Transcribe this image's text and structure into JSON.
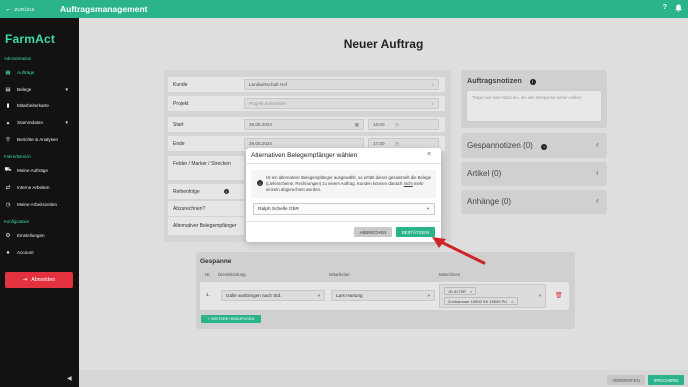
{
  "topbar": {
    "back_label": "ZURÜCK",
    "title": "Auftragsmanagement",
    "help_icon": "?",
    "bell_icon": "bell-icon"
  },
  "sidebar": {
    "logo": "FarmAct",
    "section_admin": "Administration",
    "items_admin": [
      {
        "label": "Aufträge",
        "icon": "clipboard-icon"
      },
      {
        "label": "Belege",
        "icon": "document-icon"
      },
      {
        "label": "Mitarbeiterkarte",
        "icon": "chart-icon"
      },
      {
        "label": "Stammdaten",
        "icon": "database-icon"
      },
      {
        "label": "Berichte & Analysen",
        "icon": "search-chart-icon"
      }
    ],
    "section_driver": "Fahrerbereich",
    "items_driver": [
      {
        "label": "Meine Aufträge",
        "icon": "truck-icon"
      },
      {
        "label": "Interne Arbeiten",
        "icon": "swap-icon"
      },
      {
        "label": "Meine Arbeitszeiten",
        "icon": "clock-icon"
      }
    ],
    "section_config": "Konfiguration",
    "items_config": [
      {
        "label": "Einstellungen",
        "icon": "gear-icon"
      },
      {
        "label": "Account",
        "icon": "user-icon"
      }
    ],
    "logout_label": "Abmelden"
  },
  "page": {
    "title": "Neuer Auftrag"
  },
  "form": {
    "kunde_label": "Kunde",
    "kunde_value": "Landwirtschaft Hof",
    "projekt_label": "Projekt",
    "projekt_placeholder": "Projekt auswählen",
    "start_label": "Start",
    "start_date": "29.05.2024",
    "start_time": "16:00",
    "ende_label": "Ende",
    "ende_date": "29.05.2024",
    "ende_time": "17:00",
    "felder_label": "Felder / Marker / Strecken",
    "reihenfolge_label": "Reihenfolge",
    "abzurechnen_label": "Abzurechnen?",
    "alt_label": "Alternativer Belegempfänger"
  },
  "right": {
    "notes_title": "Auftragsnotizen",
    "notes_placeholder": "Trage hier eine Notiz ein, die alle Gespanne sehen sollen.",
    "gespann_title": "Gespannotizen (0)",
    "artikel_title": "Artikel (0)",
    "anhaenge_title": "Anhänge (0)"
  },
  "gespanne": {
    "title": "Gespanne",
    "h_nr": "Nr.",
    "h_dienst": "Dienstleistung",
    "h_mitarbeiter": "Mitarbeiter",
    "h_maschinen": "Maschinen",
    "row_nr": "1.",
    "dienst_value": "Gülle ausbringen nach Std.",
    "mitarbeiter_value": "Lars Hartung",
    "machine1": "JD 6175R",
    "machine2": "Zunhammer 15500 SK 15500 PU",
    "add_label": "+ WEITERE HINZUFÜGEN"
  },
  "footer": {
    "discard_label": "VERWERFEN",
    "save_label": "SPEICHERN"
  },
  "modal": {
    "title": "Alternativen Belegempfänger wählen",
    "info_text": "Ist ein alternativer Belegempfänger ausgewählt, so erhält dieser gesammelt die Belege (Lieferscheine, Rechnungen) zu einem Auftrag. Kunden können danach nicht mehr einzeln abgerechnet werden.",
    "info_pre": "Ist ein alternativer Belegempfänger ausgewählt, so erhält dieser gesammelt die Belege (Lieferscheine, Rechnungen) zu einem Auftrag. Kunden können danach ",
    "info_em": "nicht",
    "info_post": " mehr einzeln abgerechnet werden.",
    "select_value": "Ralph Schelle GbR",
    "cancel_label": "ABBRECHEN",
    "confirm_label": "BESTÄTIGEN"
  },
  "colors": {
    "accent": "#2bb38c",
    "logo": "#3ddba6",
    "danger": "#e23240",
    "annotation_arrow": "#d0242b"
  }
}
